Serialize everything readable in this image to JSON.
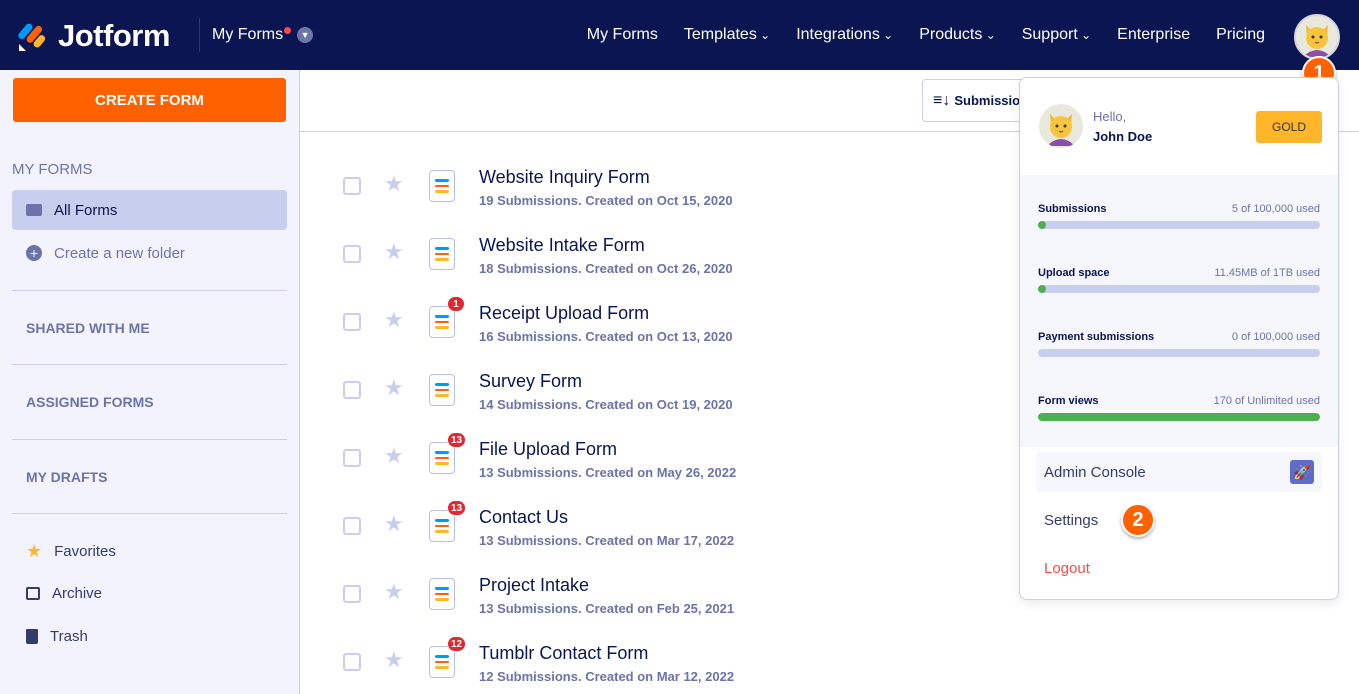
{
  "header": {
    "brand": "Jotform",
    "myforms_label": "My Forms",
    "nav": [
      "My Forms",
      "Templates",
      "Integrations",
      "Products",
      "Support",
      "Enterprise",
      "Pricing"
    ],
    "nav_has_chevron": [
      false,
      true,
      true,
      true,
      true,
      false,
      false
    ]
  },
  "sidebar": {
    "create_label": "CREATE FORM",
    "my_forms_heading": "MY FORMS",
    "all_forms": "All Forms",
    "new_folder": "Create a new folder",
    "shared": "SHARED WITH ME",
    "assigned": "ASSIGNED FORMS",
    "drafts": "MY DRAFTS",
    "favorites": "Favorites",
    "archive": "Archive",
    "trash": "Trash"
  },
  "toolbar": {
    "sort_label": "Submissions"
  },
  "forms": [
    {
      "title": "Website Inquiry Form",
      "meta": "19 Submissions. Created on Oct 15, 2020",
      "badge": null
    },
    {
      "title": "Website Intake Form",
      "meta": "18 Submissions. Created on Oct 26, 2020",
      "badge": null
    },
    {
      "title": "Receipt Upload Form",
      "meta": "16 Submissions. Created on Oct 13, 2020",
      "badge": "1"
    },
    {
      "title": "Survey Form",
      "meta": "14 Submissions. Created on Oct 19, 2020",
      "badge": null
    },
    {
      "title": "File Upload Form",
      "meta": "13 Submissions. Created on May 26, 2022",
      "badge": "13"
    },
    {
      "title": "Contact Us",
      "meta": "13 Submissions. Created on Mar 17, 2022",
      "badge": "13"
    },
    {
      "title": "Project Intake",
      "meta": "13 Submissions. Created on Feb 25, 2021",
      "badge": null
    },
    {
      "title": "Tumblr Contact Form",
      "meta": "12 Submissions. Created on Mar 12, 2022",
      "badge": "12"
    }
  ],
  "account": {
    "hello": "Hello,",
    "name": "John Doe",
    "plan": "GOLD",
    "usage": [
      {
        "label": "Submissions",
        "value": "5 of 100,000 used",
        "fill_percent": 3
      },
      {
        "label": "Upload space",
        "value": "11.45MB of 1TB used",
        "fill_percent": 3
      },
      {
        "label": "Payment submissions",
        "value": "0 of 100,000 used",
        "fill_percent": 0
      },
      {
        "label": "Form views",
        "value": "170 of Unlimited used",
        "fill_percent": 100
      }
    ],
    "admin": "Admin Console",
    "settings": "Settings",
    "logout": "Logout"
  },
  "annotations": {
    "step1": "1",
    "step2": "2"
  },
  "colors": {
    "header": "#0a1551",
    "accent": "#ff6100",
    "bar_fill": "#4caf50",
    "logout": "#ff4948"
  }
}
